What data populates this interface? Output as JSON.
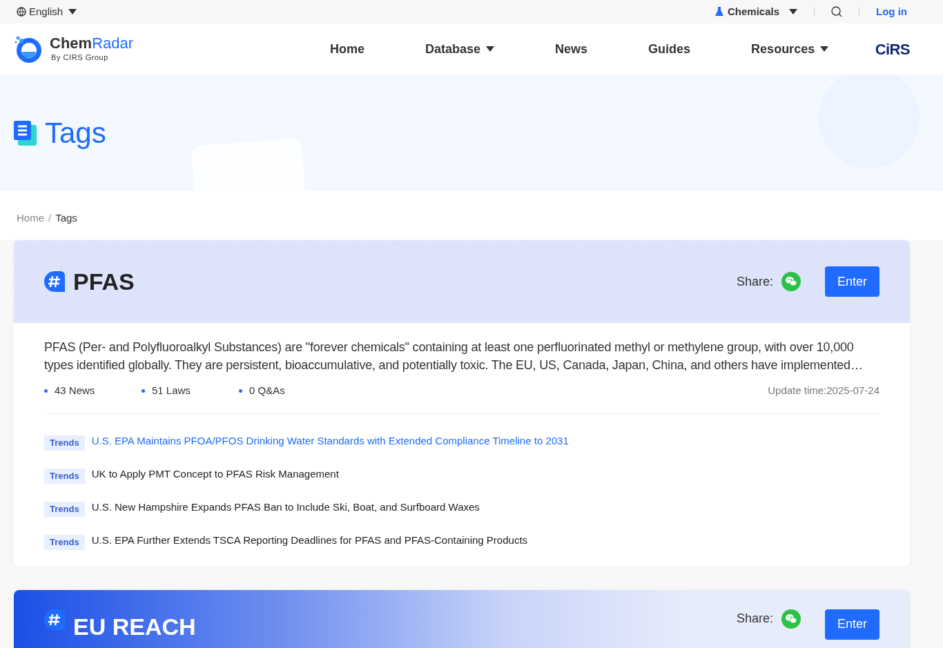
{
  "top_bar": {
    "language": "English",
    "category": "Chemicals",
    "login": "Log in"
  },
  "logo": {
    "name_bold": "Chem",
    "name_light": "Radar",
    "tagline": "By CIRS Group"
  },
  "nav": [
    {
      "label": "Home",
      "dropdown": false
    },
    {
      "label": "Database",
      "dropdown": true
    },
    {
      "label": "News",
      "dropdown": false
    },
    {
      "label": "Guides",
      "dropdown": false
    },
    {
      "label": "Resources",
      "dropdown": true
    }
  ],
  "partner_logo": "CiRS",
  "hero": {
    "title": "Tags"
  },
  "breadcrumb": [
    {
      "label": "Home",
      "current": false
    },
    {
      "label": "Tags",
      "current": true
    }
  ],
  "breadcrumb_separator": "/",
  "cards": [
    {
      "kind": "pattern",
      "title": "PFAS",
      "share_label": "Share:",
      "button": "Enter",
      "description": "PFAS (Per- and Polyfluoroalkyl Substances) are \"forever chemicals\" containing at least one perfluorinated methyl or methylene group, with over 10,000 types identified globally. They are persistent, bioaccumulative, and potentially toxic. The EU, US, Canada, Japan, China, and others have implemented…",
      "stats": [
        "43 News",
        "51 Laws",
        "0 Q&As"
      ],
      "updated": "Update time:2025-07-24",
      "articles": [
        {
          "tag": "Trends",
          "title": "U.S. EPA Maintains PFOA/PFOS Drinking Water Standards with Extended Compliance Timeline to 2031",
          "selected": true
        },
        {
          "tag": "Trends",
          "title": "UK to Apply PMT Concept to PFAS Risk Management",
          "selected": false
        },
        {
          "tag": "Trends",
          "title": "U.S. New Hampshire Expands PFAS Ban to Include Ski, Boat, and Surfboard Waxes",
          "selected": false
        },
        {
          "tag": "Trends",
          "title": "U.S. EPA Further Extends TSCA Reporting Deadlines for PFAS and PFAS-Containing Products",
          "selected": false
        }
      ]
    },
    {
      "kind": "photo",
      "title": "EU REACH",
      "share_label": "Share:",
      "button": "Enter"
    }
  ]
}
